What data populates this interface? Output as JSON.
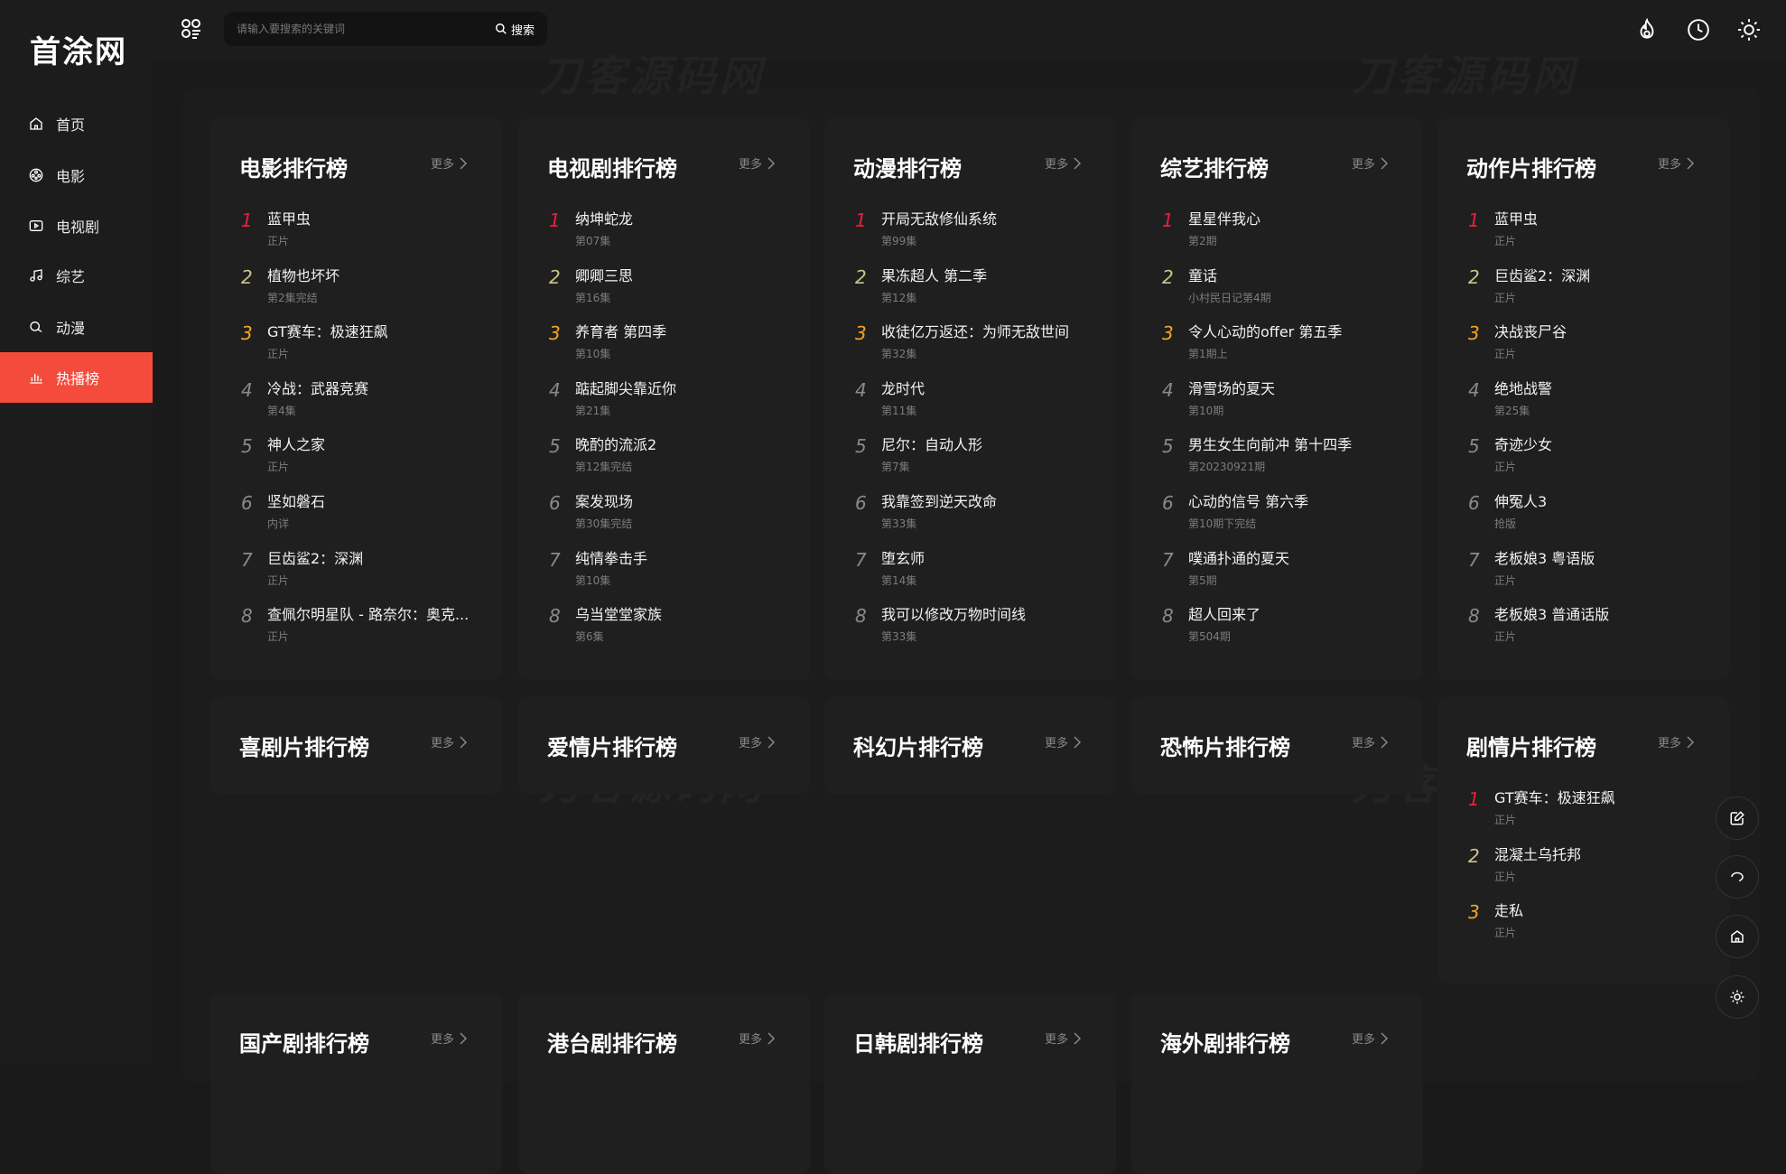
{
  "logo": "首涂网",
  "sidebar": {
    "items": [
      {
        "label": "首页",
        "icon": "home-icon"
      },
      {
        "label": "电影",
        "icon": "film-reel-icon"
      },
      {
        "label": "电视剧",
        "icon": "tv-icon"
      },
      {
        "label": "综艺",
        "icon": "music-note-icon"
      },
      {
        "label": "动漫",
        "icon": "anime-icon"
      },
      {
        "label": "热播榜",
        "icon": "bar-chart-icon",
        "active": true
      }
    ]
  },
  "search": {
    "placeholder": "请输入要搜索的关键词",
    "button": "搜索"
  },
  "watermark": "刀客源码网",
  "colors": {
    "accent": "#f54b3c",
    "rank1": "#e5213b",
    "rank2": "#c9c48a",
    "rank3": "#f5a623",
    "rank_other": "#8a8a8a"
  },
  "more_label": "更多",
  "cards": [
    {
      "title": "电影排行榜",
      "items": [
        [
          "蓝甲虫",
          "正片"
        ],
        [
          "植物也坏坏",
          "第2集完结"
        ],
        [
          "GT赛车：极速狂飙",
          "正片"
        ],
        [
          "冷战：武器竞赛",
          "第4集"
        ],
        [
          "神人之家",
          "正片"
        ],
        [
          "坚如磐石",
          "内详"
        ],
        [
          "巨齿鲨2：深渊",
          "正片"
        ],
        [
          "查佩尔明星队 - 路奈尔：奥克...",
          "正片"
        ]
      ]
    },
    {
      "title": "电视剧排行榜",
      "items": [
        [
          "纳坤蛇龙",
          "第07集"
        ],
        [
          "卿卿三思",
          "第16集"
        ],
        [
          "养育者 第四季",
          "第10集"
        ],
        [
          "踮起脚尖靠近你",
          "第21集"
        ],
        [
          "晚酌的流派2",
          "第12集完结"
        ],
        [
          "案发现场",
          "第30集完结"
        ],
        [
          "纯情拳击手",
          "第10集"
        ],
        [
          "乌当堂堂家族",
          "第6集"
        ]
      ]
    },
    {
      "title": "动漫排行榜",
      "items": [
        [
          "开局无敌修仙系统",
          "第99集"
        ],
        [
          "果冻超人 第二季",
          "第12集"
        ],
        [
          "收徒亿万返还：为师无敌世间",
          "第32集"
        ],
        [
          "龙时代",
          "第11集"
        ],
        [
          "尼尔：自动人形",
          "第7集"
        ],
        [
          "我靠签到逆天改命",
          "第33集"
        ],
        [
          "堕玄师",
          "第14集"
        ],
        [
          "我可以修改万物时间线",
          "第33集"
        ]
      ]
    },
    {
      "title": "综艺排行榜",
      "items": [
        [
          "星星伴我心",
          "第2期"
        ],
        [
          "童话",
          "小村民日记第4期"
        ],
        [
          "令人心动的offer 第五季",
          "第1期上"
        ],
        [
          "滑雪场的夏天",
          "第10期"
        ],
        [
          "男生女生向前冲 第十四季",
          "第20230921期"
        ],
        [
          "心动的信号 第六季",
          "第10期下完结"
        ],
        [
          "噗通扑通的夏天",
          "第5期"
        ],
        [
          "超人回来了",
          "第504期"
        ]
      ]
    },
    {
      "title": "动作片排行榜",
      "items": [
        [
          "蓝甲虫",
          "正片"
        ],
        [
          "巨齿鲨2：深渊",
          "正片"
        ],
        [
          "决战丧尸谷",
          "正片"
        ],
        [
          "绝地战警",
          "第25集"
        ],
        [
          "奇迹少女",
          "正片"
        ],
        [
          "伸冤人3",
          "抢版"
        ],
        [
          "老板娘3 粤语版",
          "正片"
        ],
        [
          "老板娘3 普通话版",
          "正片"
        ]
      ]
    },
    {
      "title": "喜剧片排行榜",
      "items": []
    },
    {
      "title": "爱情片排行榜",
      "items": []
    },
    {
      "title": "科幻片排行榜",
      "items": []
    },
    {
      "title": "恐怖片排行榜",
      "items": []
    },
    {
      "title": "剧情片排行榜",
      "items": [
        [
          "GT赛车：极速狂飙",
          "正片"
        ],
        [
          "混凝土乌托邦",
          "正片"
        ],
        [
          "走私",
          "正片"
        ]
      ]
    },
    {
      "title": "国产剧排行榜",
      "items": []
    },
    {
      "title": "港台剧排行榜",
      "items": []
    },
    {
      "title": "日韩剧排行榜",
      "items": []
    },
    {
      "title": "海外剧排行榜",
      "items": []
    }
  ],
  "header_icons": [
    "fire-icon",
    "history-clock-icon",
    "theme-sun-icon"
  ],
  "floating_buttons": [
    "edit-icon",
    "feedback-icon",
    "home-icon",
    "theme-sun-icon"
  ]
}
